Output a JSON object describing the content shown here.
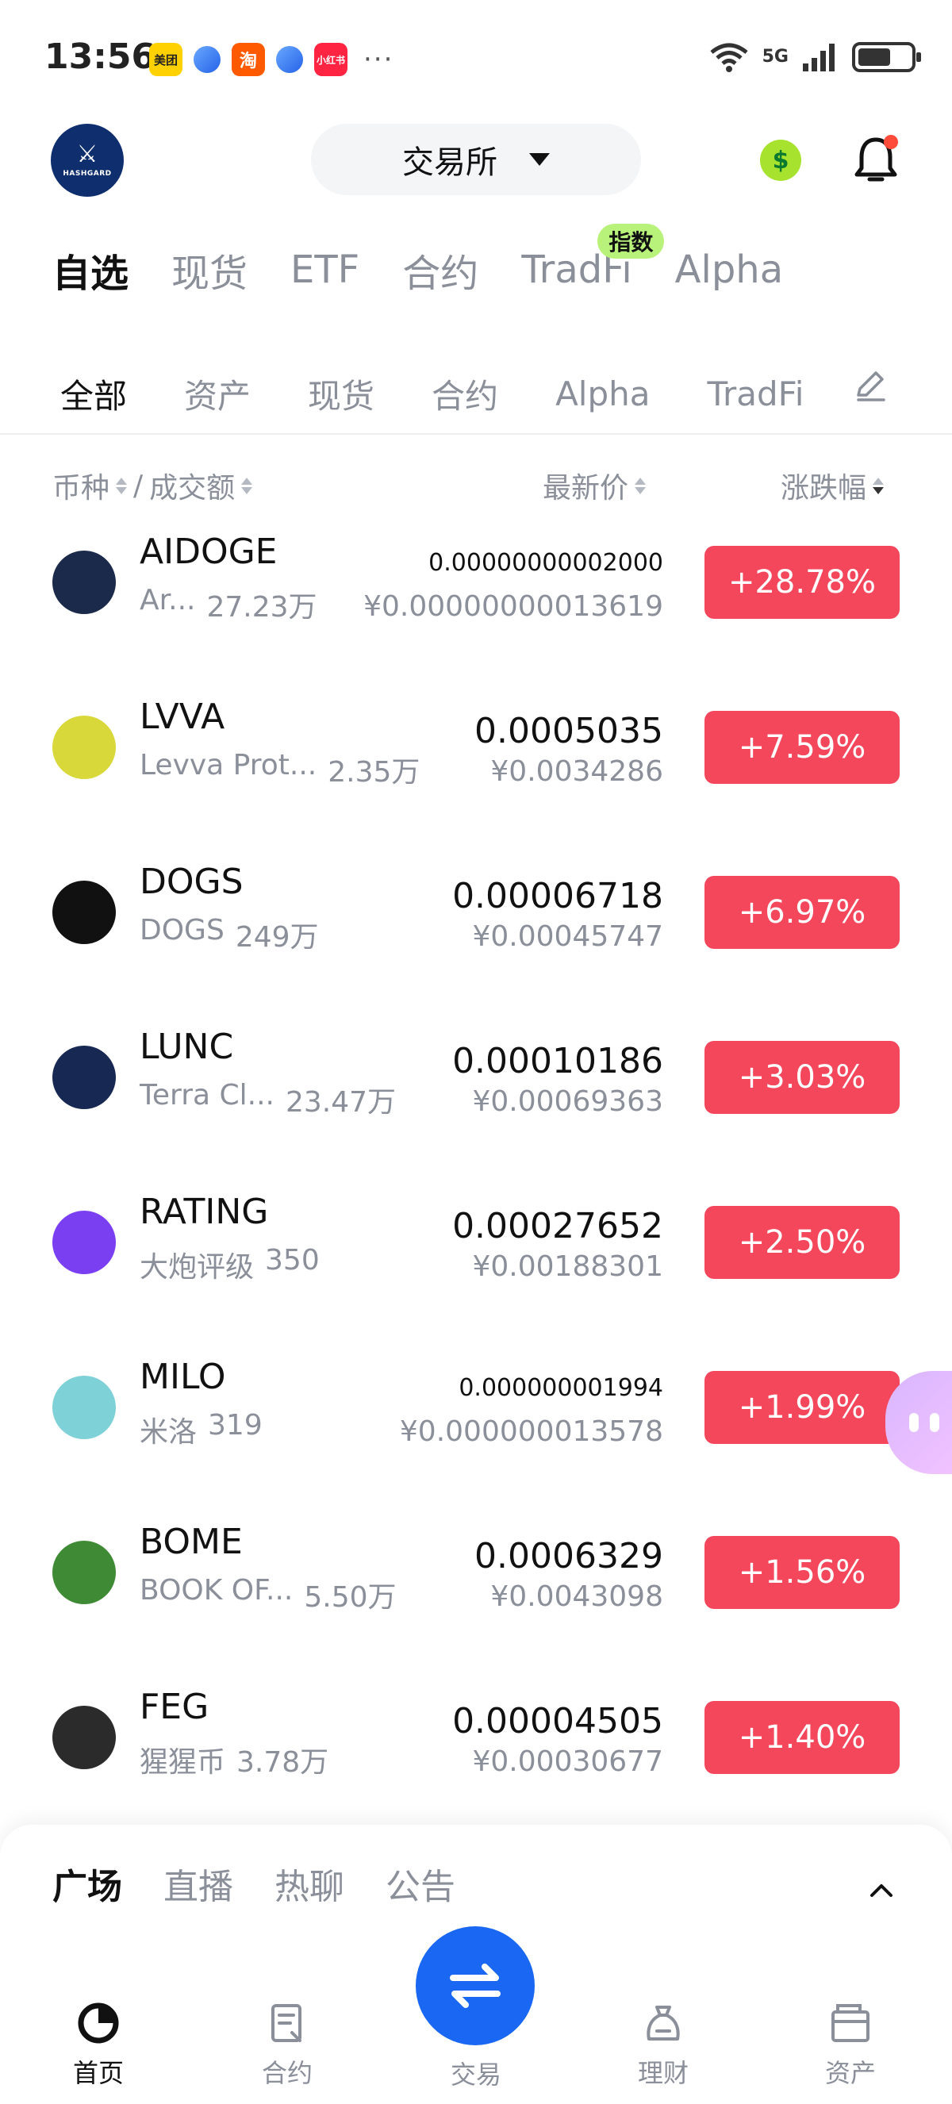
{
  "status_bar": {
    "time": "13:56",
    "apps": [
      "美团",
      "淘",
      "小红书"
    ],
    "more": "···",
    "network": "5G",
    "battery_level": 0.62
  },
  "header": {
    "logo_text": "HASHGARD",
    "exchange_label": "交易所",
    "icons": [
      "dollar-icon",
      "bell-icon",
      "chevron-down-icon"
    ]
  },
  "primary_tabs": [
    {
      "label": "自选",
      "active": true
    },
    {
      "label": "现货"
    },
    {
      "label": "ETF"
    },
    {
      "label": "合约"
    },
    {
      "label": "TradFi",
      "badge": "指数"
    },
    {
      "label": "Alpha"
    }
  ],
  "secondary_tabs": [
    {
      "label": "全部",
      "active": true
    },
    {
      "label": "资产"
    },
    {
      "label": "现货"
    },
    {
      "label": "合约"
    },
    {
      "label": "Alpha"
    },
    {
      "label": "TradFi"
    }
  ],
  "columns": {
    "coin": "币种",
    "sep": "/",
    "volume": "成交额",
    "price": "最新价",
    "change": "涨跌幅"
  },
  "coins": [
    {
      "symbol": "AIDOGE",
      "name": "Ar...",
      "volume": "27.23万",
      "price": "0.00000000002000",
      "cny": "¥0.00000000013619",
      "change": "+28.78%",
      "icon_color": "#1b2a4a"
    },
    {
      "symbol": "LVVA",
      "name": "Levva Prot...",
      "volume": "2.35万",
      "price": "0.0005035",
      "cny": "¥0.0034286",
      "change": "+7.59%",
      "icon_color": "#d9d83a"
    },
    {
      "symbol": "DOGS",
      "name": "DOGS",
      "volume": "249万",
      "price": "0.00006718",
      "cny": "¥0.00045747",
      "change": "+6.97%",
      "icon_color": "#111111"
    },
    {
      "symbol": "LUNC",
      "name": "Terra Cl...",
      "volume": "23.47万",
      "price": "0.00010186",
      "cny": "¥0.00069363",
      "change": "+3.03%",
      "icon_color": "#172852"
    },
    {
      "symbol": "RATING",
      "name": "大炮评级",
      "volume": "350",
      "price": "0.00027652",
      "cny": "¥0.00188301",
      "change": "+2.50%",
      "icon_color": "#7b3ff2"
    },
    {
      "symbol": "MILO",
      "name": "米洛",
      "volume": "319",
      "price": "0.000000001994",
      "cny": "¥0.000000013578",
      "change": "+1.99%",
      "icon_color": "#7fd1d8"
    },
    {
      "symbol": "BOME",
      "name": "BOOK OF...",
      "volume": "5.50万",
      "price": "0.0006329",
      "cny": "¥0.0043098",
      "change": "+1.56%",
      "icon_color": "#3f8a35"
    },
    {
      "symbol": "FEG",
      "name": "猩猩币",
      "volume": "3.78万",
      "price": "0.00004505",
      "cny": "¥0.00030677",
      "change": "+1.40%",
      "icon_color": "#2b2b2b"
    }
  ],
  "sheet": {
    "tabs": [
      "广场",
      "直播",
      "热聊",
      "公告"
    ]
  },
  "bottom_nav": {
    "home": "首页",
    "contracts": "合约",
    "trade": "交易",
    "finance": "理财",
    "assets": "资产"
  },
  "colors": {
    "up": "#f5475b",
    "accent": "#1967f2",
    "badge": "#b8f27a"
  }
}
